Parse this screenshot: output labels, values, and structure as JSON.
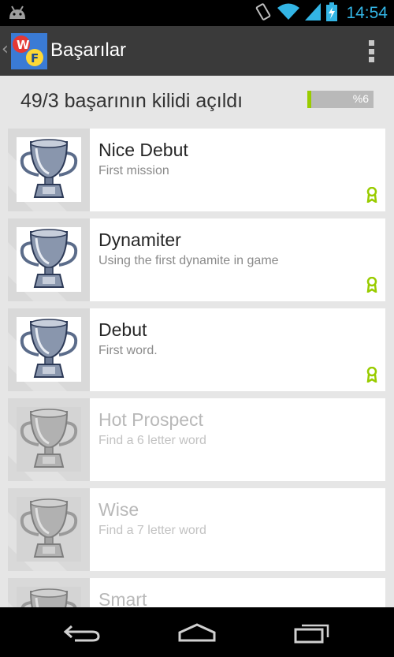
{
  "status_bar": {
    "time": "14:54",
    "icons": [
      "android-debug-icon",
      "vibrate-icon",
      "wifi-icon",
      "signal-icon",
      "battery-charging-icon"
    ],
    "accent_color": "#33b5e5"
  },
  "action_bar": {
    "title": "Başarılar",
    "logo_letters": [
      "W",
      "F"
    ],
    "background": "#3a3a3a"
  },
  "summary": {
    "text": "49/3 başarının kilidi açıldı",
    "progress_label": "%6",
    "progress_fraction": 0.06,
    "progress_color": "#99cc00"
  },
  "achievements": [
    {
      "title": "Nice Debut",
      "description": "First mission",
      "unlocked": true
    },
    {
      "title": "Dynamiter",
      "description": "Using the first dynamite in game",
      "unlocked": true
    },
    {
      "title": "Debut",
      "description": "First word.",
      "unlocked": true
    },
    {
      "title": "Hot Prospect",
      "description": "Find a 6 letter word",
      "unlocked": false
    },
    {
      "title": "Wise",
      "description": "Find a 7 letter word",
      "unlocked": false
    },
    {
      "title": "Smart",
      "description": "",
      "unlocked": false
    }
  ],
  "nav_bar": {
    "buttons": [
      "back-icon",
      "home-icon",
      "recent-apps-icon"
    ]
  }
}
